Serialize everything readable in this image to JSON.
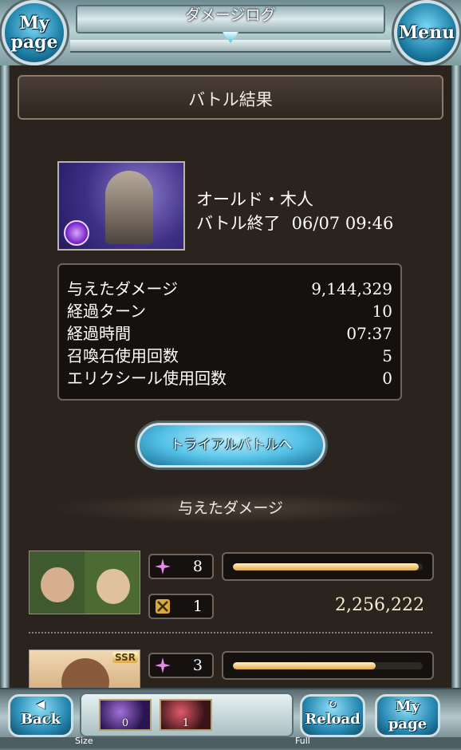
{
  "header": {
    "title": "ダメージログ",
    "mypage_label_1": "My",
    "mypage_label_2": "page",
    "menu_label": "Menu"
  },
  "battle": {
    "section_title": "バトル結果",
    "enemy_name": "オールド・木人",
    "end_label": "バトル終了",
    "end_datetime": "06/07 09:46",
    "element_color": "#8a3ad6"
  },
  "stats": [
    {
      "label": "与えたダメージ",
      "value": "9,144,329"
    },
    {
      "label": "経過ターン",
      "value": "10"
    },
    {
      "label": "経過時間",
      "value": "07:37"
    },
    {
      "label": "召喚石使用回数",
      "value": "5"
    },
    {
      "label": "エリクシール使用回数",
      "value": "0"
    }
  ],
  "trial_button": "トライアルバトルへ",
  "damage_section": {
    "heading": "与えたダメージ"
  },
  "characters": [
    {
      "ability_count": "8",
      "charge_count": "1",
      "damage": "2,256,222",
      "gauge_fraction": 0.98,
      "rarity": ""
    },
    {
      "ability_count": "3",
      "gauge_fraction": 0.75,
      "rarity": "SSR"
    }
  ],
  "bottom": {
    "back_label": "Back",
    "reload_label": "Reload",
    "mypage_label_1": "My",
    "mypage_label_2": "page",
    "potion_1_count": "0",
    "potion_2_count": "1",
    "size_label": "Size",
    "full_label": "Full"
  },
  "colors": {
    "accent": "#52c0e6",
    "gauge": "#e2a94a",
    "panel": "#2a231e"
  }
}
